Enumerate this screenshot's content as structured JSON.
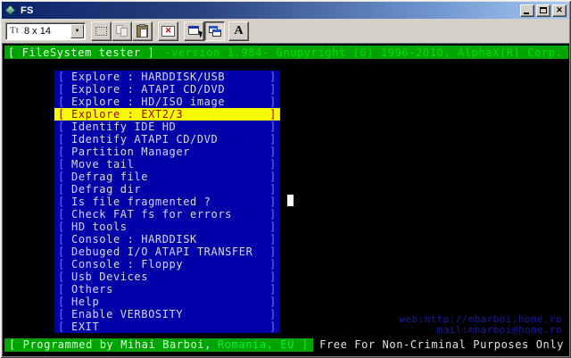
{
  "window": {
    "title": "FS"
  },
  "icons": {
    "dropdown_arrow": "▼",
    "close_glyph": "✕",
    "fullscreen_glyph": "✕",
    "truetype_glyph": "Tt"
  },
  "toolbar": {
    "font_size_value": "8 x 14",
    "font_button_label": "A"
  },
  "terminal": {
    "header": {
      "app": "[ FileSystem tester ]",
      "version": "-version 1.984- Gnupyright (G) 1996-2010, AlphaX(R) Corp."
    },
    "menu": {
      "bracket_left": "[",
      "bracket_right": "]",
      "selected_index": 3,
      "items": [
        "Explore : HARDDISK/USB",
        "Explore : ATAPI CD/DVD",
        "Explore : HD/ISO image",
        "Explore : EXT2/3",
        "Identify IDE HD",
        "Identify ATAPI CD/DVD",
        "Partition Manager",
        "Move tail",
        "Defrag file",
        "Defrag dir",
        "Is file fragmented ?",
        "Check FAT fs for errors",
        "HD tools",
        "Console : HARDDISK",
        "Debuged I/O ATAPI TRANSFER",
        "Console : Floppy",
        "Usb Devices",
        "Others",
        "Help",
        "Enable VERBOSITY",
        "EXIT"
      ]
    },
    "links": {
      "web": "web:http://mbarboi.home.ro",
      "mail": "mail:mbarboi@home.ro"
    },
    "footer": {
      "credit_plain": "[ Programmed by Mihai Barboi,",
      "credit_highlight": "Romania, EU ]",
      "license": "Free For Non-Criminal Purposes Only"
    }
  },
  "colors": {
    "dos_blue": "#0000a8",
    "bar_green": "#00a400",
    "highlight_yellow": "#f8fc00",
    "highlight_text": "#9e0000",
    "bracket_blue": "#7070ff",
    "link_blue": "#1b1b9e",
    "titlebar_gradient_start": "#0a246a",
    "titlebar_gradient_end": "#a6caf0"
  }
}
